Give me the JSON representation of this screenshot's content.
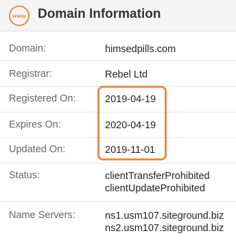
{
  "header": {
    "icon": "www-icon",
    "icon_text": "www",
    "title": "Domain Information"
  },
  "rows": [
    {
      "label": "Domain:",
      "values": [
        "himsedpills.com"
      ]
    },
    {
      "label": "Registrar:",
      "values": [
        "Rebel Ltd"
      ]
    },
    {
      "label": "Registered On:",
      "values": [
        "2019-04-19"
      ]
    },
    {
      "label": "Expires On:",
      "values": [
        "2020-04-19"
      ]
    },
    {
      "label": "Updated On:",
      "values": [
        "2019-11-01"
      ]
    },
    {
      "label": "Status:",
      "values": [
        "clientTransferProhibited",
        "clientUpdateProhibited"
      ]
    },
    {
      "label": "Name Servers:",
      "values": [
        "ns1.usm107.siteground.biz",
        "ns2.usm107.siteground.biz"
      ]
    }
  ],
  "colors": {
    "accent": "#f28a3b",
    "highlight": "#ec8a4c"
  }
}
